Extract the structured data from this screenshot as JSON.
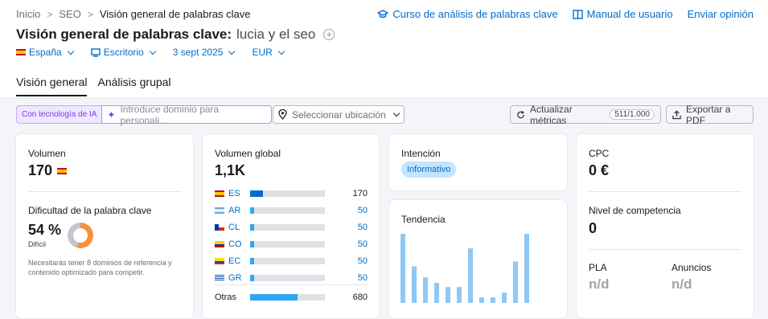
{
  "breadcrumb": {
    "home": "Inicio",
    "section": "SEO",
    "current": "Visión general de palabras clave"
  },
  "top_links": {
    "course": "Curso de análisis de palabras clave",
    "manual": "Manual de usuario",
    "feedback": "Enviar opinión"
  },
  "page": {
    "title": "Visión general de palabras clave:",
    "keyword": "lucia y el seo",
    "add_symbol": "+"
  },
  "filters": {
    "country": "España",
    "device": "Escritorio",
    "date": "3 sept 2025",
    "currency": "EUR"
  },
  "tabs": [
    "Visión general",
    "Análisis grupal"
  ],
  "toolbar": {
    "ai_label": "Con tecnología de IA",
    "domain_placeholder": "Introduce dominio para personali...",
    "location_placeholder": "Seleccionar ubicación",
    "refresh_label": "Actualizar métricas",
    "refresh_count": "511/1.000",
    "export_label": "Exportar a PDF"
  },
  "volume": {
    "label": "Volumen",
    "value": "170"
  },
  "difficulty": {
    "label": "Dificultad de la palabra clave",
    "value": "54 %",
    "level_text": "Difícil",
    "percent": 54,
    "note": "Necesitarás tener 8 dominios de referencia y contenido optimizado para competir."
  },
  "global_volume": {
    "label": "Volumen global",
    "value": "1,1K",
    "countries": [
      {
        "code": "ES",
        "value": "170",
        "share": 0.17
      },
      {
        "code": "AR",
        "value": "50",
        "share": 0.05
      },
      {
        "code": "CL",
        "value": "50",
        "share": 0.05
      },
      {
        "code": "CO",
        "value": "50",
        "share": 0.05
      },
      {
        "code": "EC",
        "value": "50",
        "share": 0.05
      },
      {
        "code": "GR",
        "value": "50",
        "share": 0.05
      }
    ],
    "others": {
      "label": "Otras",
      "value": "680",
      "share": 0.63
    }
  },
  "intent": {
    "label": "Intención",
    "value": "Informativo"
  },
  "trend": {
    "label": "Tendencia"
  },
  "chart_data": {
    "type": "bar",
    "title": "Tendencia",
    "values": [
      1.0,
      0.53,
      0.37,
      0.29,
      0.23,
      0.23,
      0.79,
      0.08,
      0.08,
      0.15,
      0.6,
      1.0
    ],
    "ylim": [
      0,
      1
    ]
  },
  "cpc": {
    "label": "CPC",
    "value": "0 €"
  },
  "competition": {
    "label": "Nivel de competencia",
    "value": "0"
  },
  "pla": {
    "label": "PLA",
    "value": "n/d"
  },
  "ads": {
    "label": "Anuncios",
    "value": "n/d"
  },
  "colors": {
    "accent": "#006dca",
    "difficulty": "#f7913d",
    "trend_bar": "#8fc8f4",
    "ai": "#7b3fe4"
  }
}
